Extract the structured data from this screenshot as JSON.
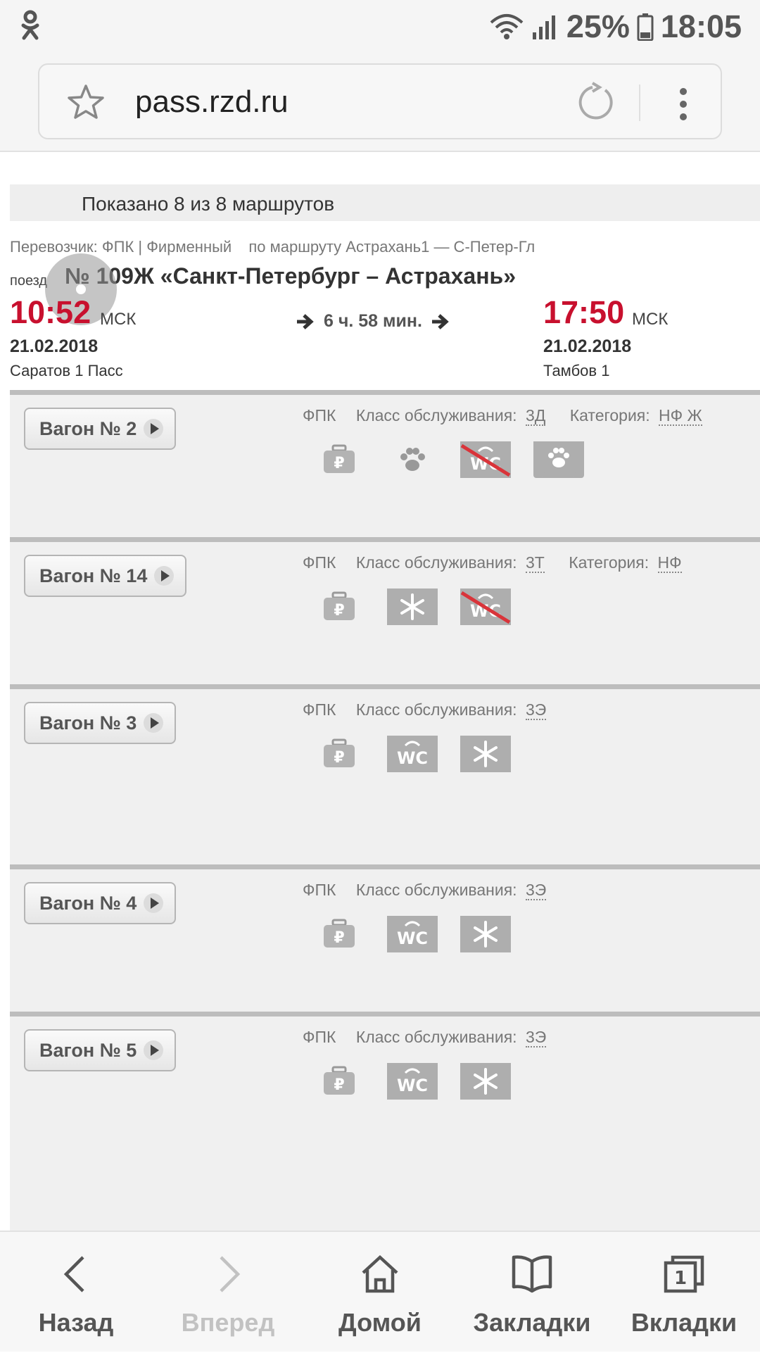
{
  "status_bar": {
    "app_icon": "odnoklassniki-icon",
    "battery": "25%",
    "time": "18:05"
  },
  "browser": {
    "url": "pass.rzd.ru"
  },
  "results": {
    "shown_text": "Показано 8 из 8 маршрутов"
  },
  "train": {
    "carrier": "Перевозчик: ФПК | Фирменный",
    "route": "по маршруту Астрахань1 — С-Петер-Гл",
    "kind": "поезд",
    "title": "№ 109Ж «Санкт-Петербург – Астрахань»",
    "departure": {
      "time": "10:52",
      "tz": "МСК",
      "date": "21.02.2018",
      "station": "Саратов 1 Пасс"
    },
    "duration": "6 ч. 58 мин.",
    "arrival": {
      "time": "17:50",
      "tz": "МСК",
      "date": "21.02.2018",
      "station": "Тамбов 1"
    }
  },
  "wagons": [
    {
      "label": "Вагон № 2",
      "carrier": "ФПК",
      "class_label": "Класс обслуживания:",
      "class": "3Д",
      "category_label": "Категория:",
      "category": "НФ Ж",
      "icons": [
        "ruble-luggage-icon",
        "paw-icon",
        "no-wc-icon",
        "pet-car-icon"
      ]
    },
    {
      "label": "Вагон № 14",
      "carrier": "ФПК",
      "class_label": "Класс обслуживания:",
      "class": "3Т",
      "category_label": "Категория:",
      "category": "НФ",
      "icons": [
        "ruble-luggage-icon",
        "snowflake-icon",
        "no-wc-icon"
      ]
    },
    {
      "label": "Вагон № 3",
      "carrier": "ФПК",
      "class_label": "Класс обслуживания:",
      "class": "3Э",
      "icons": [
        "ruble-luggage-icon",
        "wc-icon",
        "snowflake-icon"
      ]
    },
    {
      "label": "Вагон № 4",
      "carrier": "ФПК",
      "class_label": "Класс обслуживания:",
      "class": "3Э",
      "icons": [
        "ruble-luggage-icon",
        "wc-icon",
        "snowflake-icon"
      ]
    },
    {
      "label": "Вагон № 5",
      "carrier": "ФПК",
      "class_label": "Класс обслуживания:",
      "class": "3Э",
      "icons": [
        "ruble-luggage-icon",
        "wc-icon",
        "snowflake-icon"
      ]
    }
  ],
  "nav": {
    "back": "Назад",
    "forward": "Вперед",
    "home": "Домой",
    "bookmarks": "Закладки",
    "tabs": "Вкладки",
    "tabs_count": "1"
  },
  "colors": {
    "accent_red": "#c8102e",
    "icon_gray": "#aeaeae",
    "strike_red": "#d9343a"
  }
}
